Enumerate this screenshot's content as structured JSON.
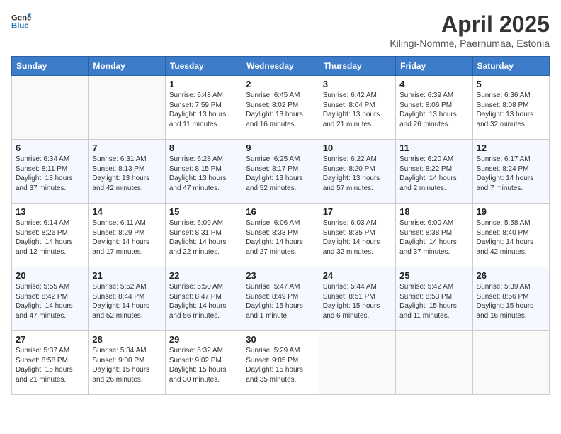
{
  "header": {
    "logo_general": "General",
    "logo_blue": "Blue",
    "title": "April 2025",
    "subtitle": "Kilingi-Nomme, Paernumaa, Estonia"
  },
  "days_of_week": [
    "Sunday",
    "Monday",
    "Tuesday",
    "Wednesday",
    "Thursday",
    "Friday",
    "Saturday"
  ],
  "weeks": [
    [
      {
        "day": "",
        "info": ""
      },
      {
        "day": "",
        "info": ""
      },
      {
        "day": "1",
        "info": "Sunrise: 6:48 AM\nSunset: 7:59 PM\nDaylight: 13 hours and 11 minutes."
      },
      {
        "day": "2",
        "info": "Sunrise: 6:45 AM\nSunset: 8:02 PM\nDaylight: 13 hours and 16 minutes."
      },
      {
        "day": "3",
        "info": "Sunrise: 6:42 AM\nSunset: 8:04 PM\nDaylight: 13 hours and 21 minutes."
      },
      {
        "day": "4",
        "info": "Sunrise: 6:39 AM\nSunset: 8:06 PM\nDaylight: 13 hours and 26 minutes."
      },
      {
        "day": "5",
        "info": "Sunrise: 6:36 AM\nSunset: 8:08 PM\nDaylight: 13 hours and 32 minutes."
      }
    ],
    [
      {
        "day": "6",
        "info": "Sunrise: 6:34 AM\nSunset: 8:11 PM\nDaylight: 13 hours and 37 minutes."
      },
      {
        "day": "7",
        "info": "Sunrise: 6:31 AM\nSunset: 8:13 PM\nDaylight: 13 hours and 42 minutes."
      },
      {
        "day": "8",
        "info": "Sunrise: 6:28 AM\nSunset: 8:15 PM\nDaylight: 13 hours and 47 minutes."
      },
      {
        "day": "9",
        "info": "Sunrise: 6:25 AM\nSunset: 8:17 PM\nDaylight: 13 hours and 52 minutes."
      },
      {
        "day": "10",
        "info": "Sunrise: 6:22 AM\nSunset: 8:20 PM\nDaylight: 13 hours and 57 minutes."
      },
      {
        "day": "11",
        "info": "Sunrise: 6:20 AM\nSunset: 8:22 PM\nDaylight: 14 hours and 2 minutes."
      },
      {
        "day": "12",
        "info": "Sunrise: 6:17 AM\nSunset: 8:24 PM\nDaylight: 14 hours and 7 minutes."
      }
    ],
    [
      {
        "day": "13",
        "info": "Sunrise: 6:14 AM\nSunset: 8:26 PM\nDaylight: 14 hours and 12 minutes."
      },
      {
        "day": "14",
        "info": "Sunrise: 6:11 AM\nSunset: 8:29 PM\nDaylight: 14 hours and 17 minutes."
      },
      {
        "day": "15",
        "info": "Sunrise: 6:09 AM\nSunset: 8:31 PM\nDaylight: 14 hours and 22 minutes."
      },
      {
        "day": "16",
        "info": "Sunrise: 6:06 AM\nSunset: 8:33 PM\nDaylight: 14 hours and 27 minutes."
      },
      {
        "day": "17",
        "info": "Sunrise: 6:03 AM\nSunset: 8:35 PM\nDaylight: 14 hours and 32 minutes."
      },
      {
        "day": "18",
        "info": "Sunrise: 6:00 AM\nSunset: 8:38 PM\nDaylight: 14 hours and 37 minutes."
      },
      {
        "day": "19",
        "info": "Sunrise: 5:58 AM\nSunset: 8:40 PM\nDaylight: 14 hours and 42 minutes."
      }
    ],
    [
      {
        "day": "20",
        "info": "Sunrise: 5:55 AM\nSunset: 8:42 PM\nDaylight: 14 hours and 47 minutes."
      },
      {
        "day": "21",
        "info": "Sunrise: 5:52 AM\nSunset: 8:44 PM\nDaylight: 14 hours and 52 minutes."
      },
      {
        "day": "22",
        "info": "Sunrise: 5:50 AM\nSunset: 8:47 PM\nDaylight: 14 hours and 56 minutes."
      },
      {
        "day": "23",
        "info": "Sunrise: 5:47 AM\nSunset: 8:49 PM\nDaylight: 15 hours and 1 minute."
      },
      {
        "day": "24",
        "info": "Sunrise: 5:44 AM\nSunset: 8:51 PM\nDaylight: 15 hours and 6 minutes."
      },
      {
        "day": "25",
        "info": "Sunrise: 5:42 AM\nSunset: 8:53 PM\nDaylight: 15 hours and 11 minutes."
      },
      {
        "day": "26",
        "info": "Sunrise: 5:39 AM\nSunset: 8:56 PM\nDaylight: 15 hours and 16 minutes."
      }
    ],
    [
      {
        "day": "27",
        "info": "Sunrise: 5:37 AM\nSunset: 8:58 PM\nDaylight: 15 hours and 21 minutes."
      },
      {
        "day": "28",
        "info": "Sunrise: 5:34 AM\nSunset: 9:00 PM\nDaylight: 15 hours and 26 minutes."
      },
      {
        "day": "29",
        "info": "Sunrise: 5:32 AM\nSunset: 9:02 PM\nDaylight: 15 hours and 30 minutes."
      },
      {
        "day": "30",
        "info": "Sunrise: 5:29 AM\nSunset: 9:05 PM\nDaylight: 15 hours and 35 minutes."
      },
      {
        "day": "",
        "info": ""
      },
      {
        "day": "",
        "info": ""
      },
      {
        "day": "",
        "info": ""
      }
    ]
  ]
}
